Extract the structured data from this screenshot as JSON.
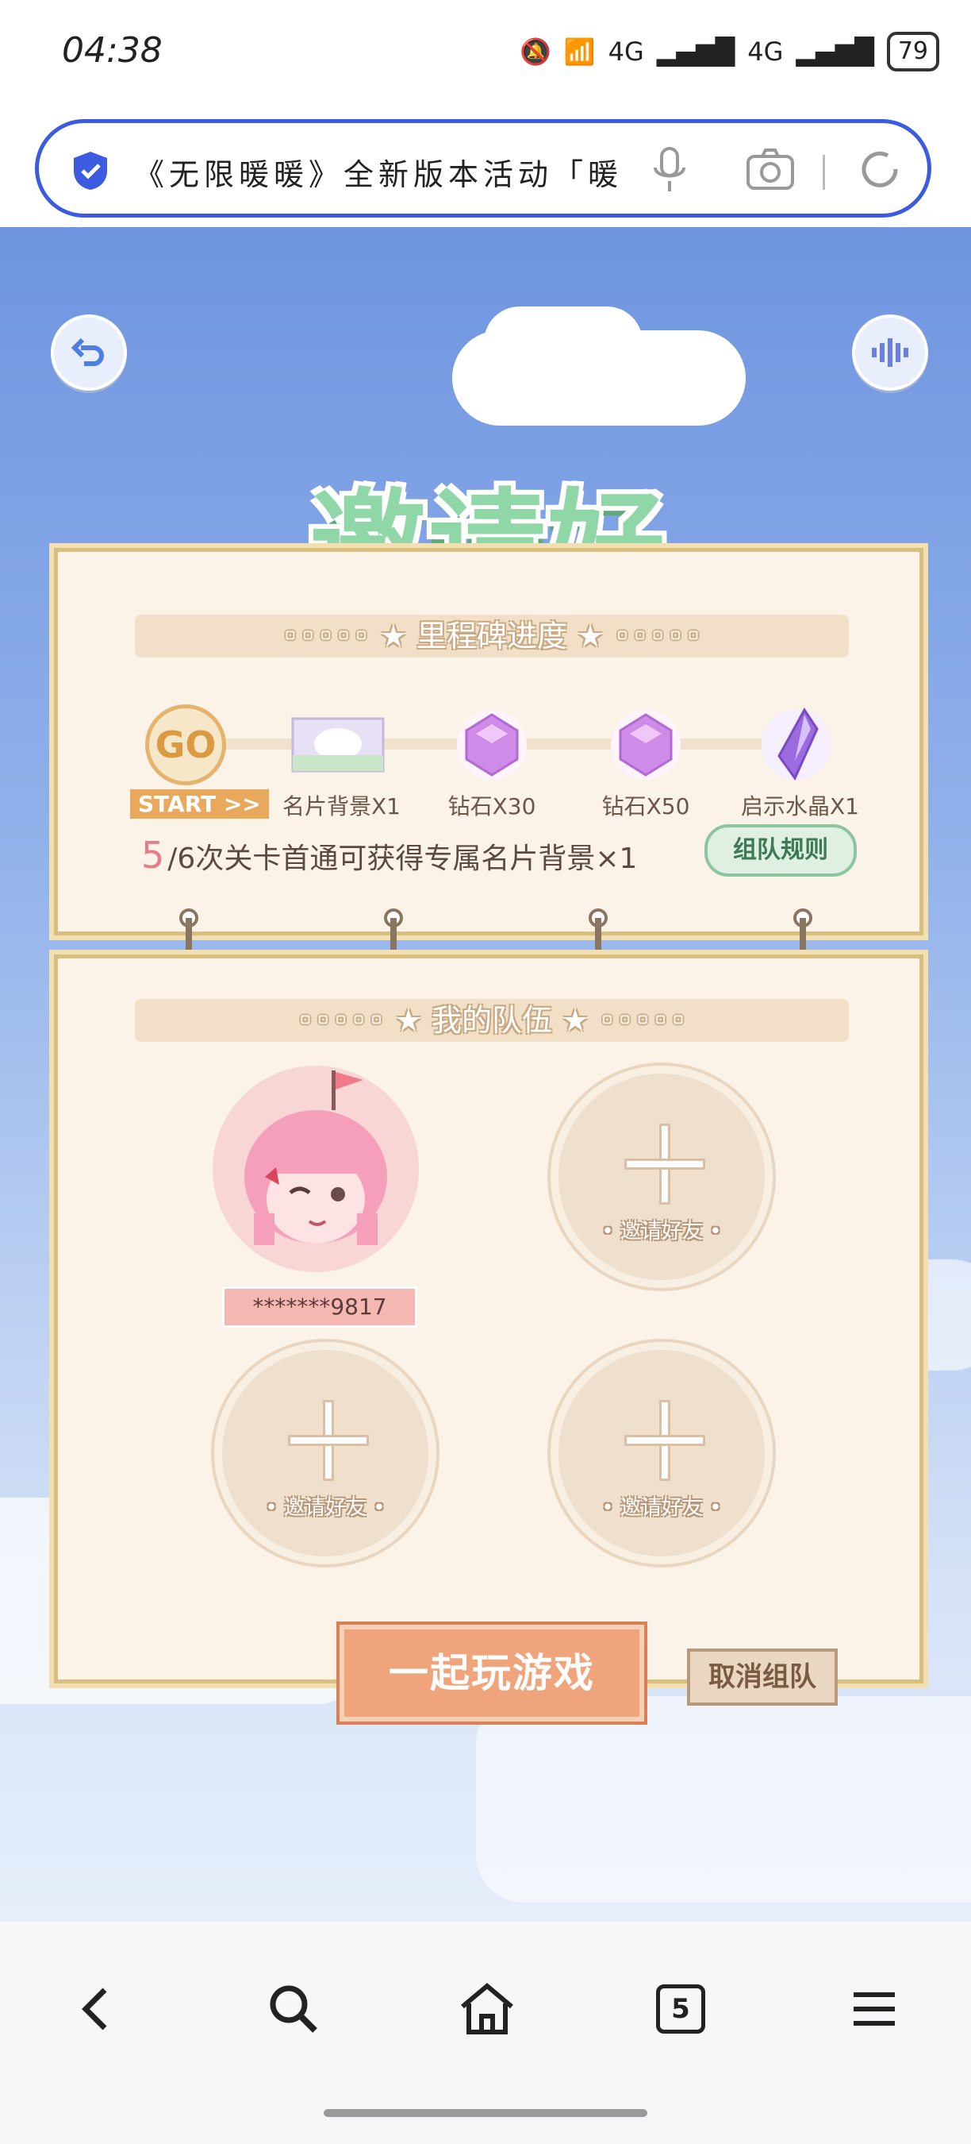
{
  "status_bar": {
    "time": "04:38",
    "network_1": "4G",
    "network_2": "4G",
    "battery": "79"
  },
  "browser": {
    "url_text": "《无限暖暖》全新版本活动「暖",
    "tab_count": "5"
  },
  "page": {
    "title": "邀请好友",
    "milestone_banner": "◦◦◦◦◦ ★ 里程碑进度 ★ ◦◦◦◦◦",
    "milestones": [
      {
        "icon": "go-icon",
        "label": "START >>",
        "icon_text": "GO"
      },
      {
        "icon": "card-background-icon",
        "label": "名片背景X1"
      },
      {
        "icon": "diamond-icon",
        "label": "钻石X30"
      },
      {
        "icon": "diamond-icon",
        "label": "钻石X50"
      },
      {
        "icon": "crystal-icon",
        "label": "启示水晶X1"
      }
    ],
    "progress": {
      "count": "5",
      "text": "/6次关卡首通可获得专属名片背景×1"
    },
    "rules_button": "组队规则",
    "team_banner": "◦◦◦◦◦ ★ 我的队伍 ★ ◦◦◦◦◦",
    "member": {
      "name": "*******9817"
    },
    "invite_label": "• 邀请好友 •",
    "play_button": "一起玩游戏",
    "cancel_button": "取消组队"
  },
  "colors": {
    "accent": "#3b5be0",
    "title_green": "#8fd7a6",
    "play_orange": "#f0a47c"
  }
}
